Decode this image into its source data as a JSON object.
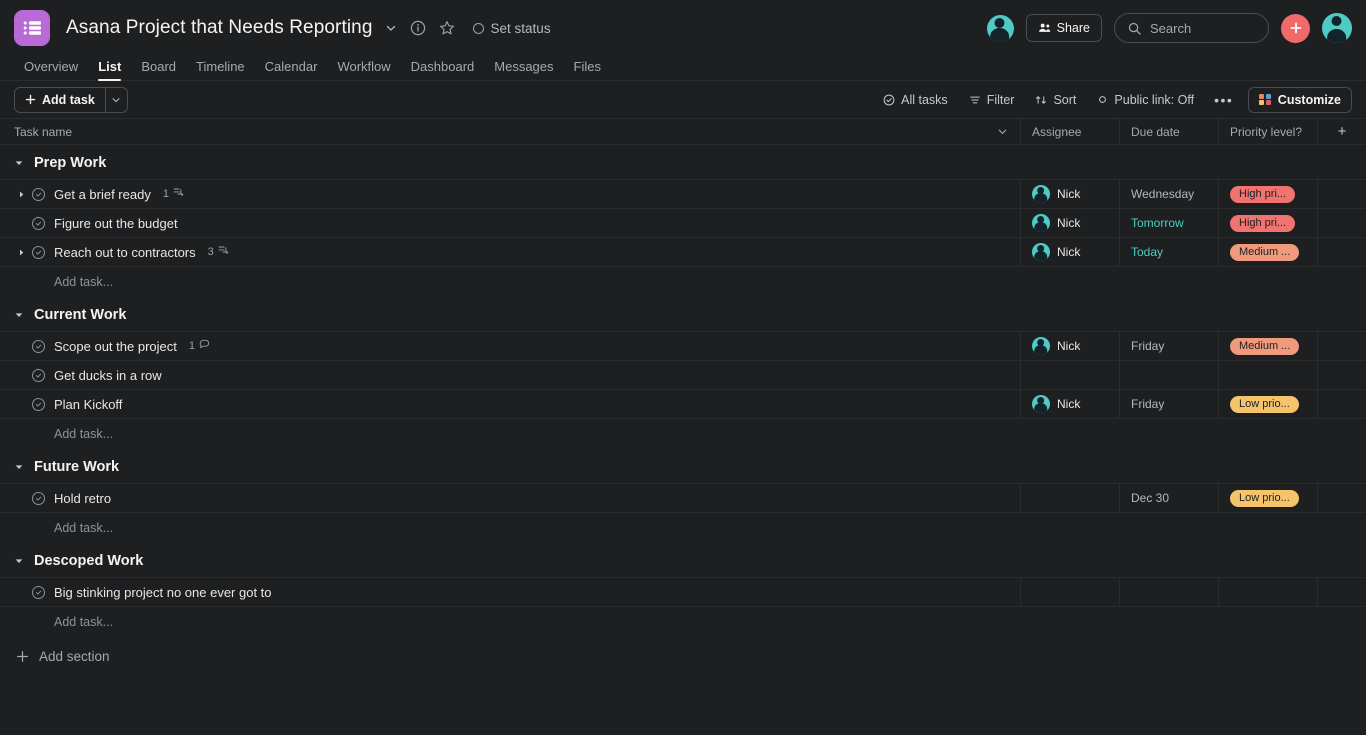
{
  "header": {
    "project_icon": "list-icon",
    "title": "Asana Project that Needs Reporting",
    "title_caret": "chevron-down-icon",
    "info_icon": "info-icon",
    "star_icon": "star-icon",
    "set_status_label": "Set status",
    "share_label": "Share",
    "search_placeholder": "Search",
    "plus_label": "+"
  },
  "tabs": [
    {
      "label": "Overview",
      "active": false
    },
    {
      "label": "List",
      "active": true
    },
    {
      "label": "Board",
      "active": false
    },
    {
      "label": "Timeline",
      "active": false
    },
    {
      "label": "Calendar",
      "active": false
    },
    {
      "label": "Workflow",
      "active": false
    },
    {
      "label": "Dashboard",
      "active": false
    },
    {
      "label": "Messages",
      "active": false
    },
    {
      "label": "Files",
      "active": false
    }
  ],
  "toolbar": {
    "add_task_label": "Add task",
    "all_tasks_label": "All tasks",
    "filter_label": "Filter",
    "sort_label": "Sort",
    "public_link_label": "Public link: Off",
    "more_label": "•••",
    "customize_label": "Customize"
  },
  "columns": {
    "task_name": "Task name",
    "assignee": "Assignee",
    "due_date": "Due date",
    "priority": "Priority level?",
    "add_column": "+"
  },
  "colors": {
    "accent_purple": "#b86bd6",
    "accent_red": "#f06a6a",
    "high_priority": "#f0736f",
    "medium_priority": "#ef9a7d",
    "low_priority": "#f5c46a",
    "due_soon": "#4ecbc4",
    "avatar_bg": "#4ecbc4"
  },
  "sections": [
    {
      "name": "Prep Work",
      "add_task_label": "Add task...",
      "tasks": [
        {
          "name": "Get a brief ready",
          "expandable": true,
          "meta_count": "1",
          "meta_icon": "subtask-icon",
          "assignee": "Nick",
          "due_date": "Wednesday",
          "due_soon": false,
          "priority": "High pri...",
          "priority_color": "#f0736f"
        },
        {
          "name": "Figure out the budget",
          "expandable": false,
          "meta_count": "",
          "meta_icon": "",
          "assignee": "Nick",
          "due_date": "Tomorrow",
          "due_soon": true,
          "priority": "High pri...",
          "priority_color": "#f0736f"
        },
        {
          "name": "Reach out to contractors",
          "expandable": true,
          "meta_count": "3",
          "meta_icon": "subtask-icon",
          "assignee": "Nick",
          "due_date": "Today",
          "due_soon": true,
          "priority": "Medium ...",
          "priority_color": "#ef9a7d"
        }
      ]
    },
    {
      "name": "Current Work",
      "add_task_label": "Add task...",
      "tasks": [
        {
          "name": "Scope out the project",
          "expandable": false,
          "meta_count": "1",
          "meta_icon": "comment-icon",
          "assignee": "Nick",
          "due_date": "Friday",
          "due_soon": false,
          "priority": "Medium ...",
          "priority_color": "#ef9a7d"
        },
        {
          "name": "Get ducks in a row",
          "expandable": false,
          "meta_count": "",
          "meta_icon": "",
          "assignee": "",
          "due_date": "",
          "due_soon": false,
          "priority": "",
          "priority_color": ""
        },
        {
          "name": "Plan Kickoff",
          "expandable": false,
          "meta_count": "",
          "meta_icon": "",
          "assignee": "Nick",
          "due_date": "Friday",
          "due_soon": false,
          "priority": "Low prio...",
          "priority_color": "#f5c46a"
        }
      ]
    },
    {
      "name": "Future Work",
      "add_task_label": "Add task...",
      "tasks": [
        {
          "name": "Hold retro",
          "expandable": false,
          "meta_count": "",
          "meta_icon": "",
          "assignee": "",
          "due_date": "Dec 30",
          "due_soon": false,
          "priority": "Low prio...",
          "priority_color": "#f5c46a"
        }
      ]
    },
    {
      "name": "Descoped Work",
      "add_task_label": "Add task...",
      "tasks": [
        {
          "name": "Big stinking project no one ever got to",
          "expandable": false,
          "meta_count": "",
          "meta_icon": "",
          "assignee": "",
          "due_date": "",
          "due_soon": false,
          "priority": "",
          "priority_color": ""
        }
      ]
    }
  ],
  "footer": {
    "add_section_label": "Add section"
  }
}
